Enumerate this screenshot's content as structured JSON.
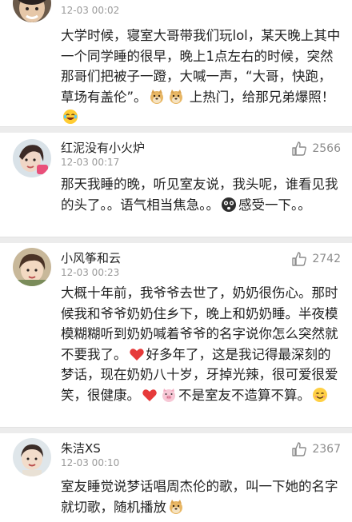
{
  "comments": [
    {
      "username": "",
      "time": "12-03 00:02",
      "likes": "",
      "text": [
        {
          "t": "大学时候，寝室大哥带我们玩lol，某天晚上其中一个同学睡的很早，晚上1点左右的时候，突然那哥们把被子一蹬，大喊一声，“大哥，快跑，草场有盖伦”。"
        },
        {
          "emoji": "doge-emoji"
        },
        {
          "emoji": "doge-emoji"
        },
        {
          "t": " 上热门，给那兄弟爆照！"
        },
        {
          "emoji": "laugh-cry-emoji"
        }
      ]
    },
    {
      "username": "红泥没有小火炉",
      "time": "12-03 00:17",
      "likes": "2566",
      "text": [
        {
          "t": "那天我睡的晚，听见室友说，我头呢，谁看见我的头了。。语气相当焦急。。"
        },
        {
          "emoji": "shocked-emoji"
        },
        {
          "t": "感受一下。。"
        }
      ]
    },
    {
      "username": "小风筝和云",
      "time": "12-03 00:23",
      "likes": "2742",
      "text": [
        {
          "t": "大概十年前，我爷爷去世了，奶奶很伤心。那时候我和爷爷奶奶住乡下，晚上和奶奶睡。半夜模模糊糊听到奶奶喊着爷爷的名字说你怎么突然就不要我了。"
        },
        {
          "emoji": "heart-emoji"
        },
        {
          "t": "好多年了，这是我记得最深刻的梦话，现在奶奶八十岁，牙掉光辣，很可爱很爱笑，很健康。"
        },
        {
          "emoji": "heart-emoji"
        },
        {
          "emoji": "pig-emoji"
        },
        {
          "t": "不是室友不造算不算。"
        },
        {
          "emoji": "smile-emoji"
        }
      ]
    },
    {
      "username": "朱洁XS",
      "time": "12-03 00:10",
      "likes": "2367",
      "text": [
        {
          "t": "室友睡觉说梦话唱周杰伦的歌，叫一下她的名字就切歌，随机播放"
        },
        {
          "emoji": "doge-emoji"
        }
      ]
    }
  ],
  "icons": {
    "like": "thumbs-up-icon"
  },
  "colors": {
    "text": "#1f1f1f",
    "meta": "#9a9a9a",
    "like": "#8c8c8c",
    "separator": "#ececec",
    "heart": "#e63a3a"
  }
}
